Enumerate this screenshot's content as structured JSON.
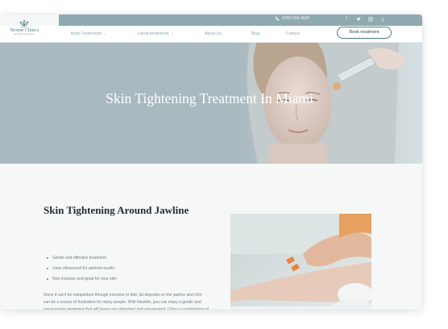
{
  "header": {
    "phone": "(505) 555-4525",
    "social_icons": [
      "facebook-icon",
      "twitter-icon",
      "instagram-icon",
      "yelp-icon"
    ],
    "logo_name": "Nexme Clinics",
    "logo_tagline": "Aesthetic Excellence",
    "nav": [
      {
        "label": "Body-Treatments",
        "has_dropdown": true
      },
      {
        "label": "Facial-treatments",
        "has_dropdown": true
      },
      {
        "label": "About Us",
        "has_dropdown": false
      },
      {
        "label": "Blog",
        "has_dropdown": false
      },
      {
        "label": "Contact",
        "has_dropdown": false
      }
    ],
    "book_button": "Book treatment"
  },
  "hero": {
    "title": "Skin Tightening Treatment In Miami"
  },
  "section": {
    "heading": "Skin Tightening Around Jawline",
    "bullets": [
      "Gentle and effective treatment",
      "Uses ultrasound for optimal results",
      "Non-invasive and great for your skin"
    ],
    "paragraph": "Since it can't be vanquished through exercise or diet, fat deposits on the jawline and chin can be a source of frustration for many people. With NewMe, you can enjoy a gentle and non-invasive treatment that will leave you refreshed and rejuvenated. Using a combination of heat and"
  },
  "colors": {
    "topbar": "#8fa9b0",
    "accent": "#4f7c86",
    "heading": "#1e2b2e",
    "body_text": "#6f8085"
  }
}
